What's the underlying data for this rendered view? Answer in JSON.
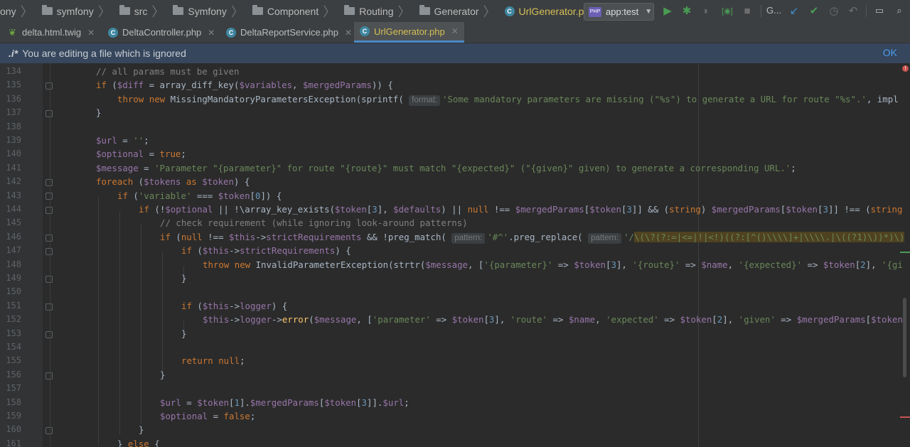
{
  "navbar": {
    "crumbs": [
      "ony",
      "symfony",
      "src",
      "Symfony",
      "Component",
      "Routing",
      "Generator",
      "UrlGenerator.php"
    ],
    "run_config": "app:test",
    "vcs_label": "G..."
  },
  "tabs": [
    {
      "label": "delta.html.twig",
      "icon": "twig-file-icon"
    },
    {
      "label": "DeltaController.php",
      "icon": "php-file-icon"
    },
    {
      "label": "DeltaReportService.php",
      "icon": "php-file-icon"
    },
    {
      "label": "UrlGenerator.php",
      "icon": "php-file-icon",
      "active": true
    }
  ],
  "banner": {
    "icon_text": ".i*",
    "message": "You are editing a file which is ignored",
    "ok_label": "OK"
  },
  "editor": {
    "line_numbers": [
      "134",
      "135",
      "136",
      "137",
      "138",
      "139",
      "140",
      "141",
      "142",
      "143",
      "144",
      "145",
      "146",
      "147",
      "148",
      "149",
      "150",
      "151",
      "152",
      "153",
      "154",
      "155",
      "156",
      "157",
      "158",
      "159",
      "160",
      "161"
    ],
    "hints": {
      "format": "format:",
      "pattern1": "pattern:",
      "pattern2": "pattern:"
    }
  },
  "colors": {
    "accent": "#4a88c7",
    "keyword": "#cc7832",
    "variable": "#9876aa",
    "string": "#6a8759",
    "comment": "#808080",
    "active_tab_text": "#d6bf55"
  }
}
